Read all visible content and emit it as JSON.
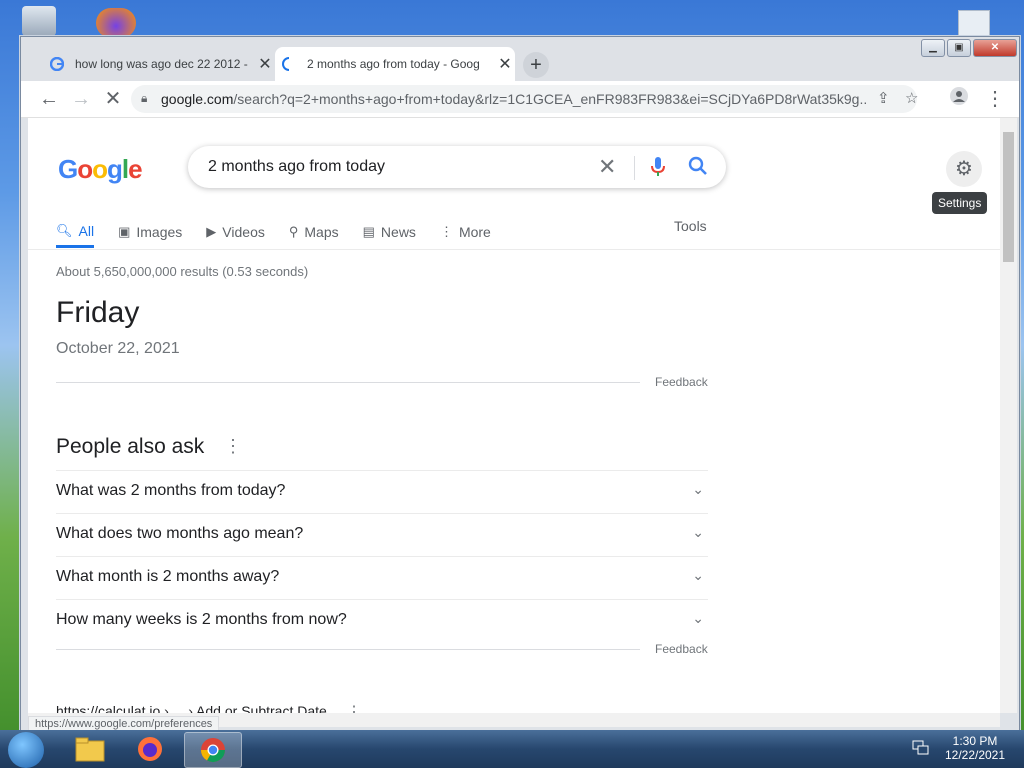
{
  "browser": {
    "tabs": [
      {
        "title": "how long was ago dec 22 2012 -",
        "active": false
      },
      {
        "title": "2 months ago from today - Goog",
        "active": true
      }
    ],
    "url_host": "google.com",
    "url_rest": "/search?q=2+months+ago+from+today&rlz=1C1GCEA_enFR983FR983&ei=SCjDYa6PD8rWat35k9g..."
  },
  "search": {
    "query": "2 months ago from today",
    "settings_tooltip": "Settings",
    "tabs": [
      "All",
      "Images",
      "Videos",
      "Maps",
      "News",
      "More"
    ],
    "tools_label": "Tools",
    "stats": "About 5,650,000,000 results (0.53 seconds)"
  },
  "answer": {
    "day": "Friday",
    "date": "October 22, 2021",
    "feedback": "Feedback"
  },
  "people_also_ask": {
    "title": "People also ask",
    "questions": [
      "What was 2 months from today?",
      "What does two months ago mean?",
      "What month is 2 months away?",
      "How many weeks is 2 months from now?"
    ],
    "feedback": "Feedback"
  },
  "result": {
    "cite": "https://calculat.io › ... › Add or Subtract Date"
  },
  "status_url": "https://www.google.com/preferences",
  "taskbar": {
    "time": "1:30 PM",
    "date": "12/22/2021"
  },
  "colors": {
    "accent": "#1a73e8",
    "mic_red": "#ea4335"
  }
}
